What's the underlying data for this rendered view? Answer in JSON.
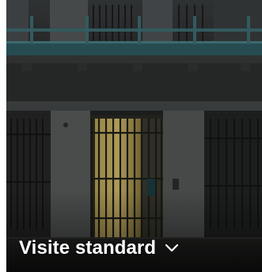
{
  "card": {
    "title": "Visite standard",
    "expand_icon": "chevron-down-icon",
    "title_color": "#ffffff"
  }
}
